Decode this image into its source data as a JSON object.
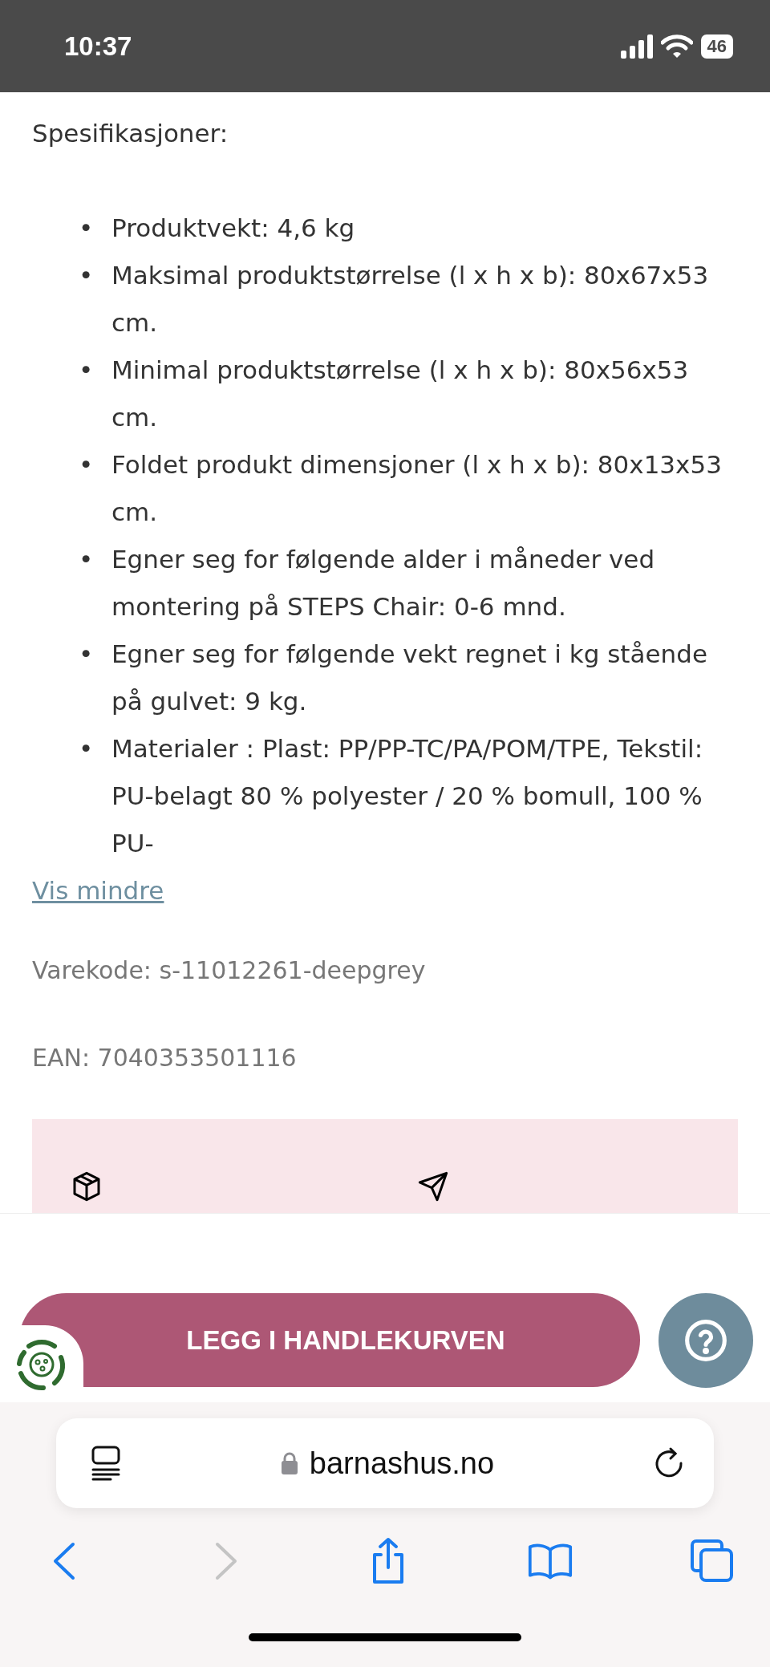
{
  "status_bar": {
    "time": "10:37",
    "battery": "46"
  },
  "specs": {
    "heading": "Spesifikasjoner:",
    "bullet": "•",
    "items": [
      "Produktvekt: 4,6 kg",
      "Maksimal produktstørrelse (l x h x b): 80x67x53 cm.",
      "Minimal produktstørrelse (l x h x b): 80x56x53 cm.",
      "Foldet produkt dimensjoner (l x h x b): 80x13x53 cm.",
      "Egner seg for følgende alder i måneder ved montering på STEPS Chair: 0-6 mnd.",
      "Egner seg for følgende vekt regnet i kg stående på gulvet: 9 kg.",
      "Materialer : Plast: PP/PP-TC/PA/POM/TPE, Tekstil: PU-belagt 80 % polyester / 20 % bomull, 100 % PU-"
    ]
  },
  "toggle_link": "Vis mindre",
  "product_codes": [
    "Varekode: s-11012261-deepgrey",
    "EAN: 7040353501116"
  ],
  "cart_button": {
    "label": "LEGG I HANDLEKURVEN"
  },
  "browser": {
    "url": "barnashus.no",
    "back_disabled": false,
    "forward_disabled": true
  }
}
